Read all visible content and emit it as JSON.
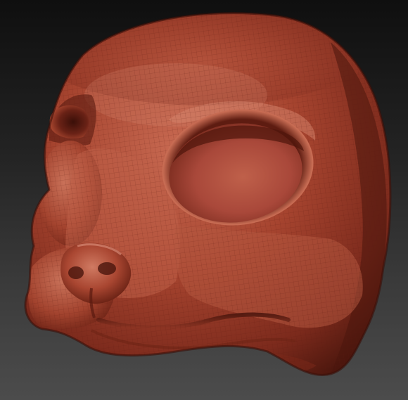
{
  "viewport": {
    "background_top": "#0f0f0f",
    "background_bottom": "#4c4c4c"
  },
  "model": {
    "subject": "animal-head-mask-sculpt",
    "material_color": "#a0402c",
    "material_highlight": "#d07a62",
    "material_shadow": "#3e120b",
    "wire_color": "#7a2e1f",
    "wire_visible": true
  }
}
